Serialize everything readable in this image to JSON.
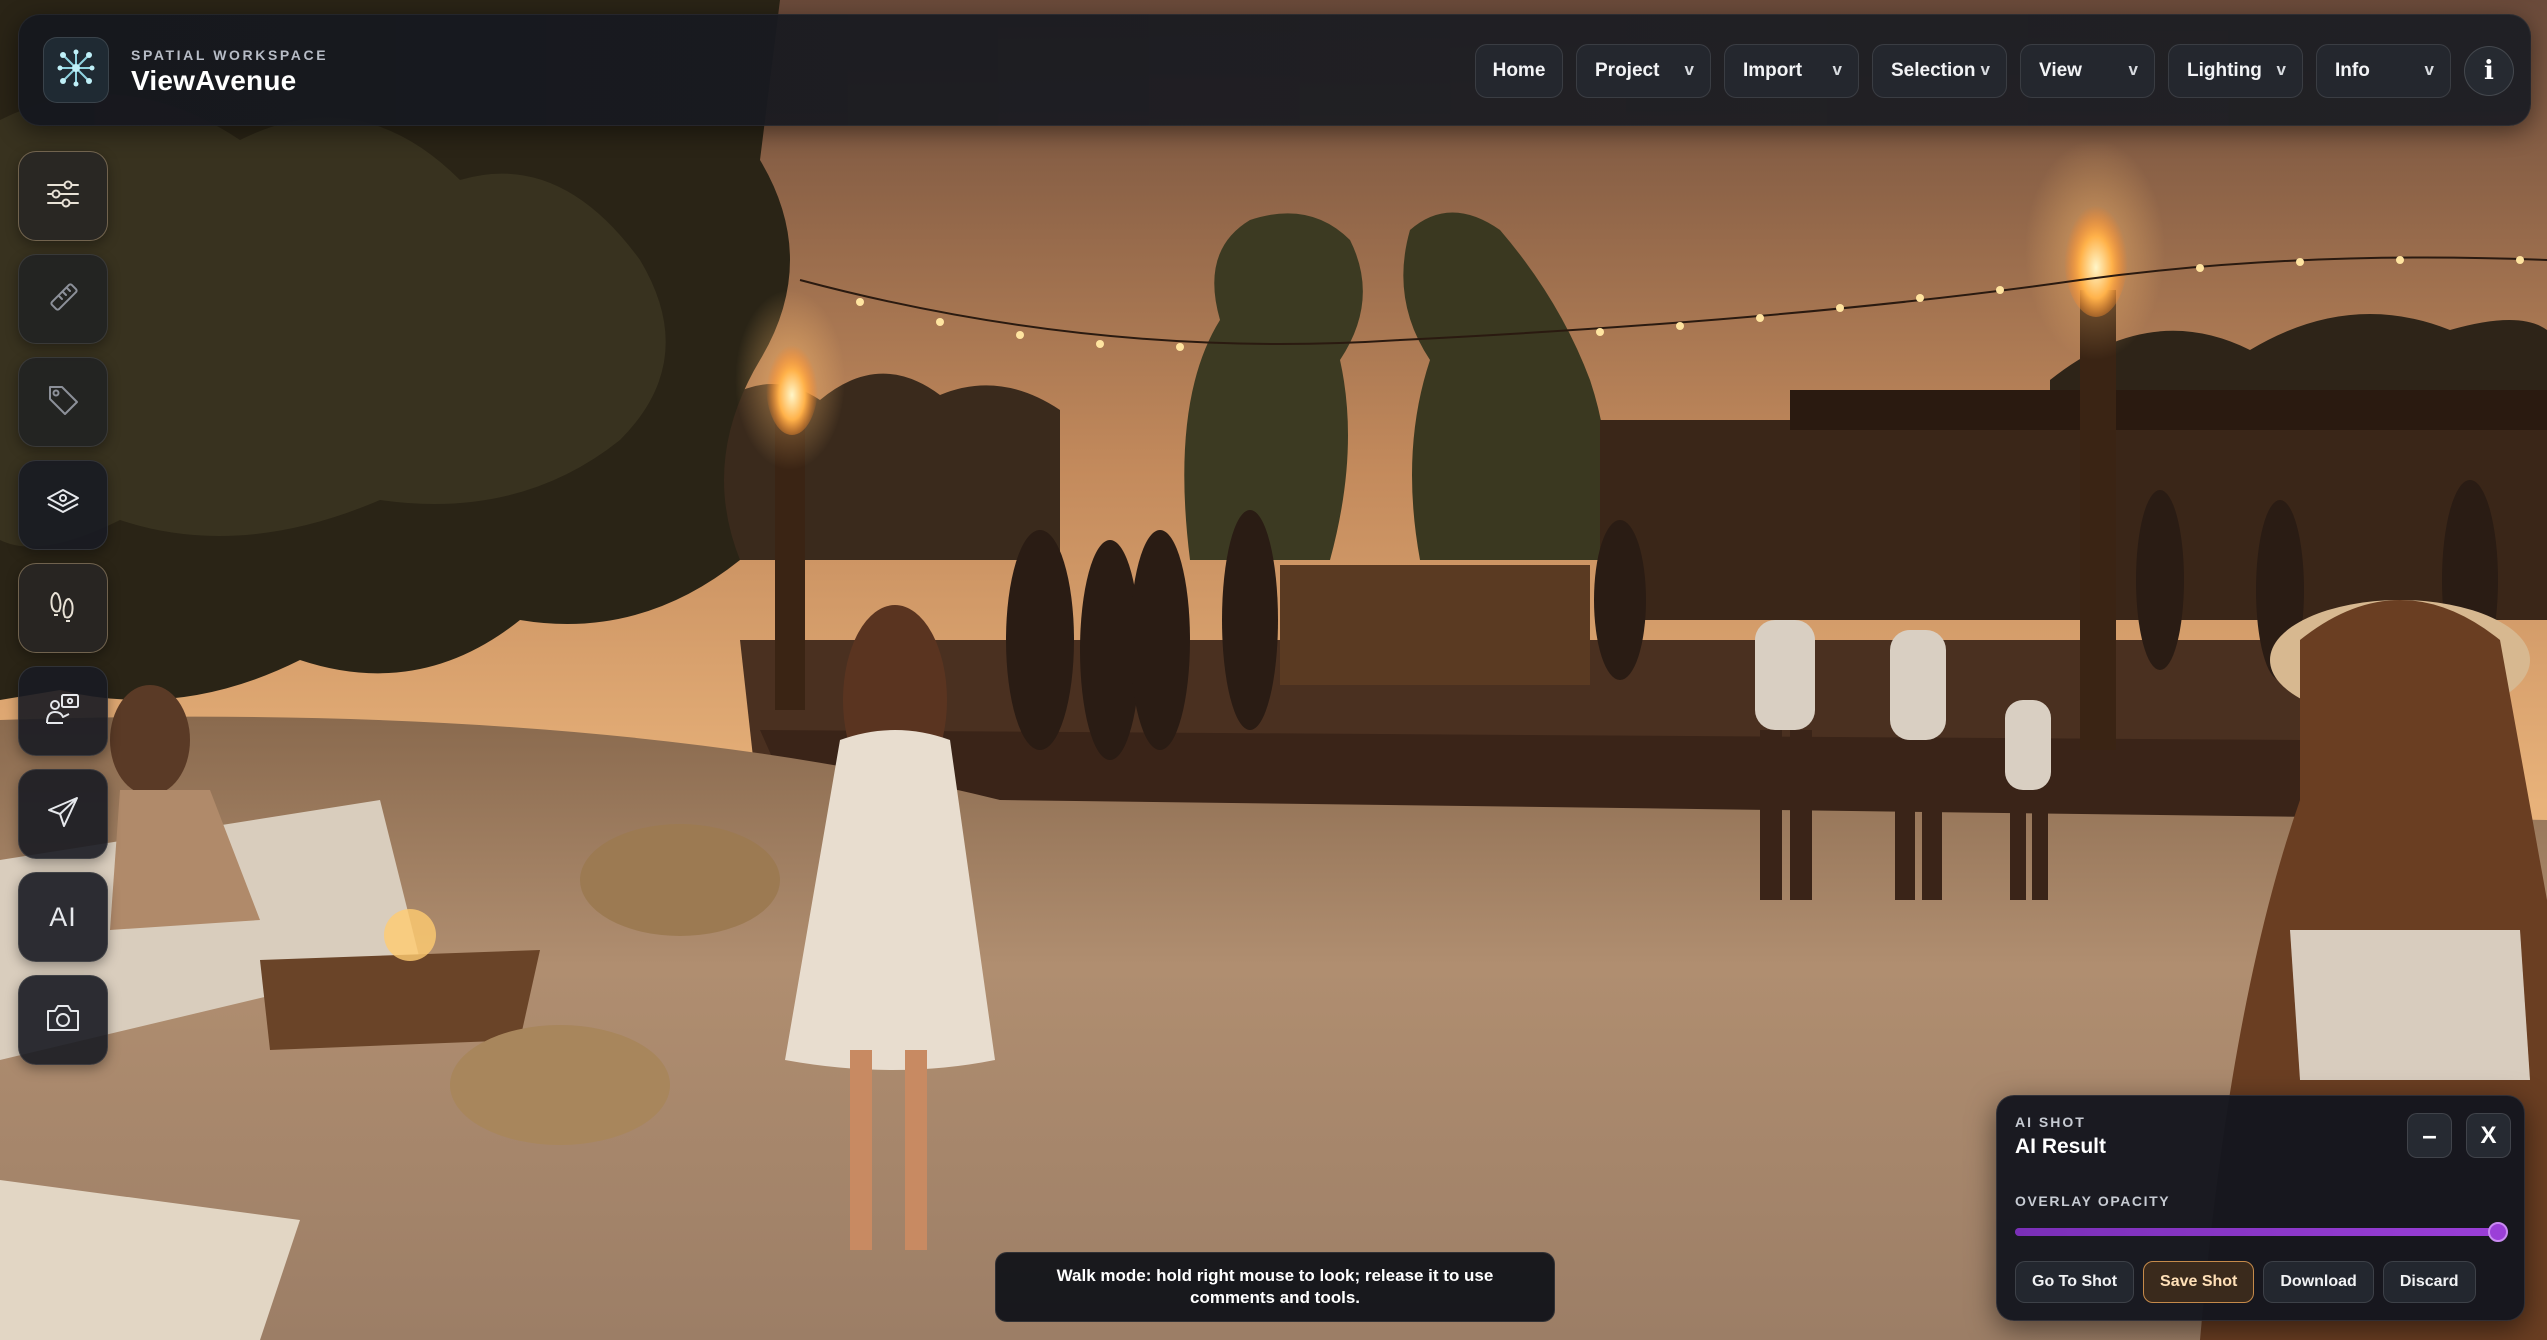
{
  "app": {
    "eyebrow": "SPATIAL WORKSPACE",
    "title": "ViewAvenue",
    "logo_icon": "network-nodes-icon"
  },
  "nav": {
    "home": "Home",
    "menus": [
      {
        "label": "Project",
        "chevron": "v"
      },
      {
        "label": "Import",
        "chevron": "v"
      },
      {
        "label": "Selection",
        "chevron": "v"
      },
      {
        "label": "View",
        "chevron": "v"
      },
      {
        "label": "Lighting",
        "chevron": "v"
      },
      {
        "label": "Info",
        "chevron": "v"
      }
    ],
    "info_button": "i"
  },
  "toolbar": {
    "tools": [
      {
        "icon": "sliders-icon",
        "active": true
      },
      {
        "icon": "ruler-icon",
        "dimmed": true
      },
      {
        "icon": "tag-icon",
        "dimmed": true
      },
      {
        "icon": "layers-icon"
      },
      {
        "icon": "footsteps-icon",
        "active": true
      },
      {
        "icon": "person-board-icon"
      },
      {
        "icon": "paper-plane-icon"
      },
      {
        "icon": "ai-icon",
        "label": "AI"
      },
      {
        "icon": "camera-icon"
      }
    ]
  },
  "ai_panel": {
    "eyebrow": "AI SHOT",
    "title": "AI Result",
    "minimize": "–",
    "close": "X",
    "overlay_label": "OVERLAY OPACITY",
    "overlay_opacity": 1.0,
    "actions": {
      "go_to_shot": "Go To Shot",
      "save_shot": "Save Shot",
      "download": "Download",
      "discard": "Discard"
    }
  },
  "toast": {
    "message": "Walk mode: hold right mouse to look; release it to use comments and tools."
  },
  "colors": {
    "accent": "#9b3fd8",
    "save_accent": "#c58a4a",
    "chrome": "#16181e"
  }
}
